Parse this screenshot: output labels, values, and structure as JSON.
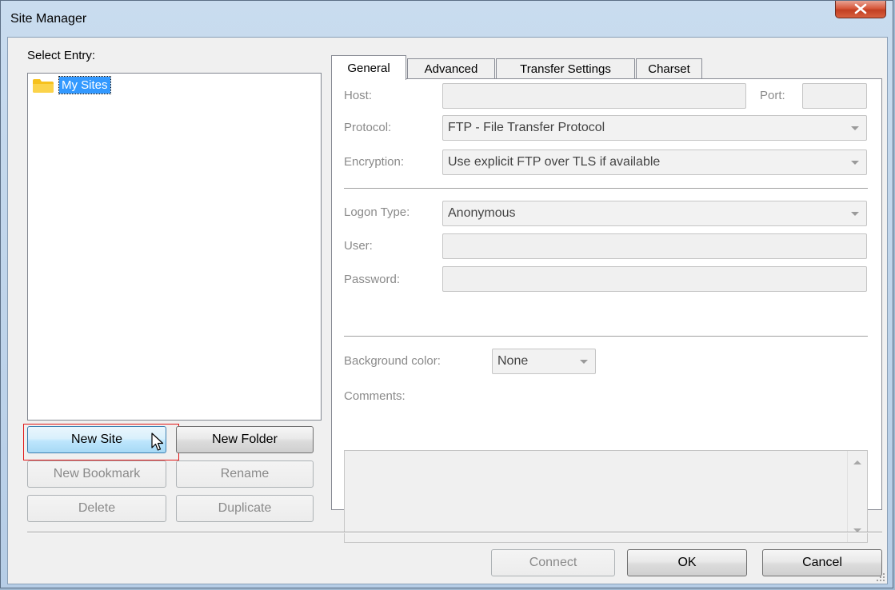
{
  "window": {
    "title": "Site Manager"
  },
  "left": {
    "select_entry_label": "Select Entry:",
    "tree_root": "My Sites",
    "buttons": {
      "new_site": "New Site",
      "new_folder": "New Folder",
      "new_bookmark": "New Bookmark",
      "rename": "Rename",
      "delete": "Delete",
      "duplicate": "Duplicate"
    }
  },
  "tabs": [
    "General",
    "Advanced",
    "Transfer Settings",
    "Charset"
  ],
  "general": {
    "host_label": "Host:",
    "port_label": "Port:",
    "protocol_label": "Protocol:",
    "protocol_value": "FTP - File Transfer Protocol",
    "encryption_label": "Encryption:",
    "encryption_value": "Use explicit FTP over TLS if available",
    "logon_type_label": "Logon Type:",
    "logon_type_value": "Anonymous",
    "user_label": "User:",
    "password_label": "Password:",
    "bg_color_label": "Background color:",
    "bg_color_value": "None",
    "comments_label": "Comments:"
  },
  "footer": {
    "connect": "Connect",
    "ok": "OK",
    "cancel": "Cancel"
  },
  "colors": {
    "selection": "#3399ff",
    "focus_highlight": "#e01818",
    "close_button": "#c23f22"
  }
}
